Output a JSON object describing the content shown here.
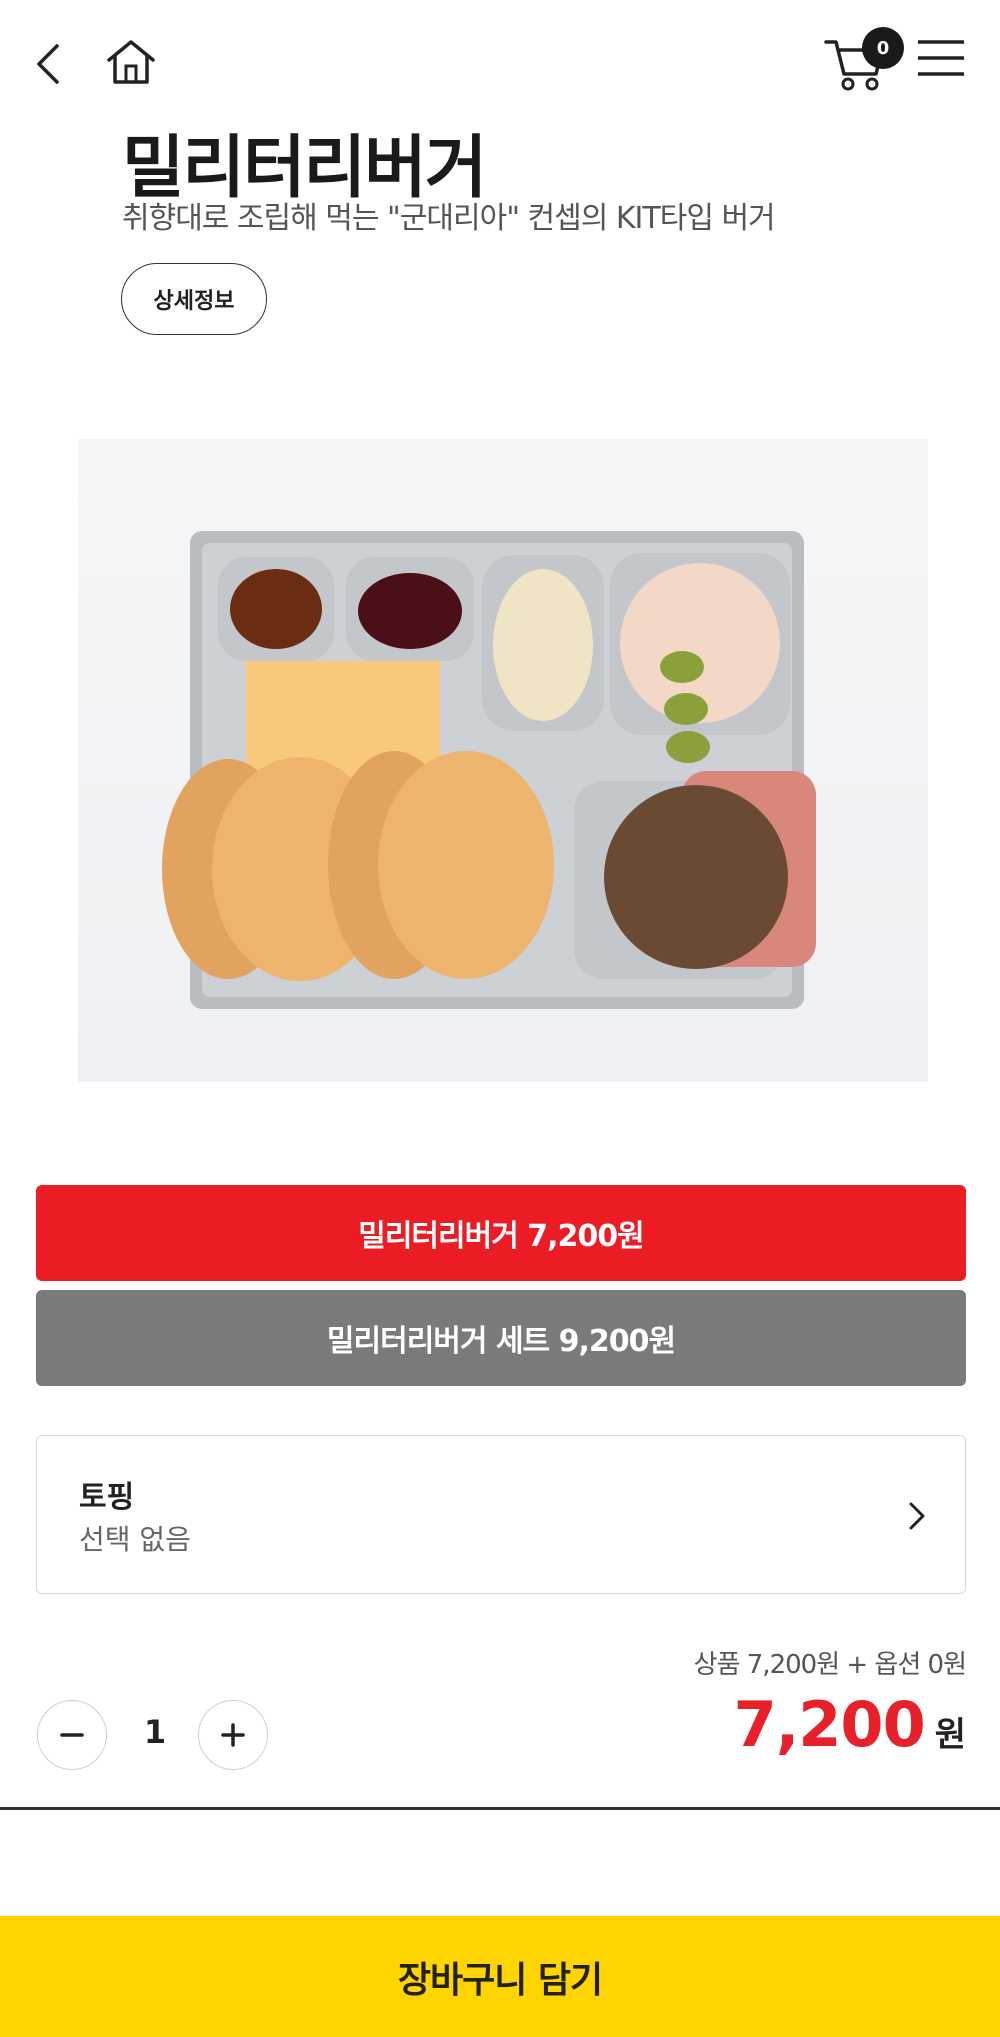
{
  "header": {
    "back_icon": "chevron-left-icon",
    "home_icon": "home-icon",
    "cart_icon": "cart-icon",
    "cart_count": "0",
    "menu_icon": "hamburger-menu-icon"
  },
  "product": {
    "title": "밀리터리버거",
    "subtitle": "취향대로 조립해 먹는 \"군대리아\" 컨셉의 KIT타입 버거",
    "detail_button": "상세정보"
  },
  "options": [
    {
      "label": "밀리터리버거 7,200원",
      "color": "#ec1c24",
      "selected": true
    },
    {
      "label": "밀리터리버거 세트 9,200원",
      "color": "#7a7a7a",
      "selected": false
    }
  ],
  "topping": {
    "title": "토핑",
    "value": "선택 없음"
  },
  "price": {
    "summary": "상품 7,200원 + 옵션 0원",
    "total": "7,200",
    "unit": "원"
  },
  "quantity": {
    "value": "1",
    "minus_icon": "minus-icon",
    "plus_icon": "plus-icon"
  },
  "footer": {
    "add_to_cart": "장바구니 담기",
    "color": "#ffd400"
  }
}
